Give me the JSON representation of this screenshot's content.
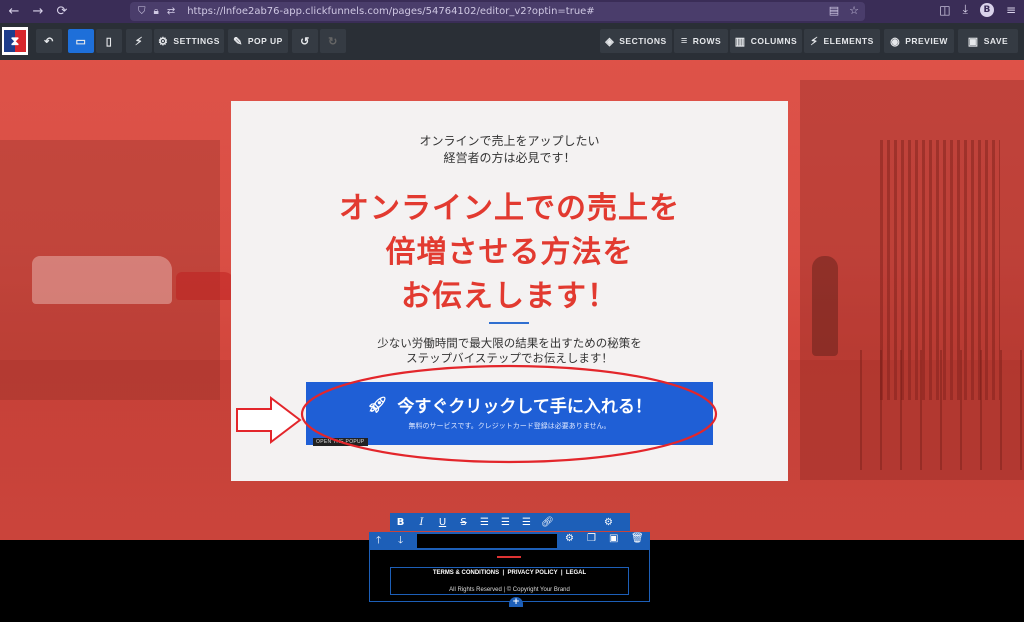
{
  "browser": {
    "url": "https://lnfoe2ab76-app.clickfunnels.com/pages/54764102/editor_v2?optin=true#",
    "profile_initial": "B"
  },
  "toolbar": {
    "settings_label": "SETTINGS",
    "popup_label": "POP UP",
    "sections_label": "SECTIONS",
    "rows_label": "ROWS",
    "columns_label": "COLUMNS",
    "elements_label": "ELEMENTS",
    "preview_label": "PREVIEW",
    "save_label": "SAVE"
  },
  "popup_card": {
    "sub_heading_line1": "オンラインで売上をアップしたい",
    "sub_heading_line2": "経営者の方は必見です！",
    "main_heading_line1": "オンライン上での売上を",
    "main_heading_line2": "倍増させる方法を",
    "main_heading_line3": "お伝えします！",
    "description_line1": "少ない労働時間で最大限の結果を出すための秘策を",
    "description_line2": "ステップバイステップでお伝えします！",
    "cta_main": "今すぐクリックして手に入れる！",
    "cta_sub": "無料のサービスです。クレジットカード登録は必要ありません。",
    "badge": "OPEN THE POPUP"
  },
  "footer": {
    "links": "TERMS & CONDITIONS  |  PRIVACY POLICY  |  LEGAL",
    "copyright": "All Rights Reserved | © Copyright Your Brand"
  },
  "colors": {
    "accent_blue": "#1f5fd6",
    "headline_red": "#e23a30",
    "annotation_red": "#e3262b",
    "toolbar_bg": "#2a2f36"
  }
}
